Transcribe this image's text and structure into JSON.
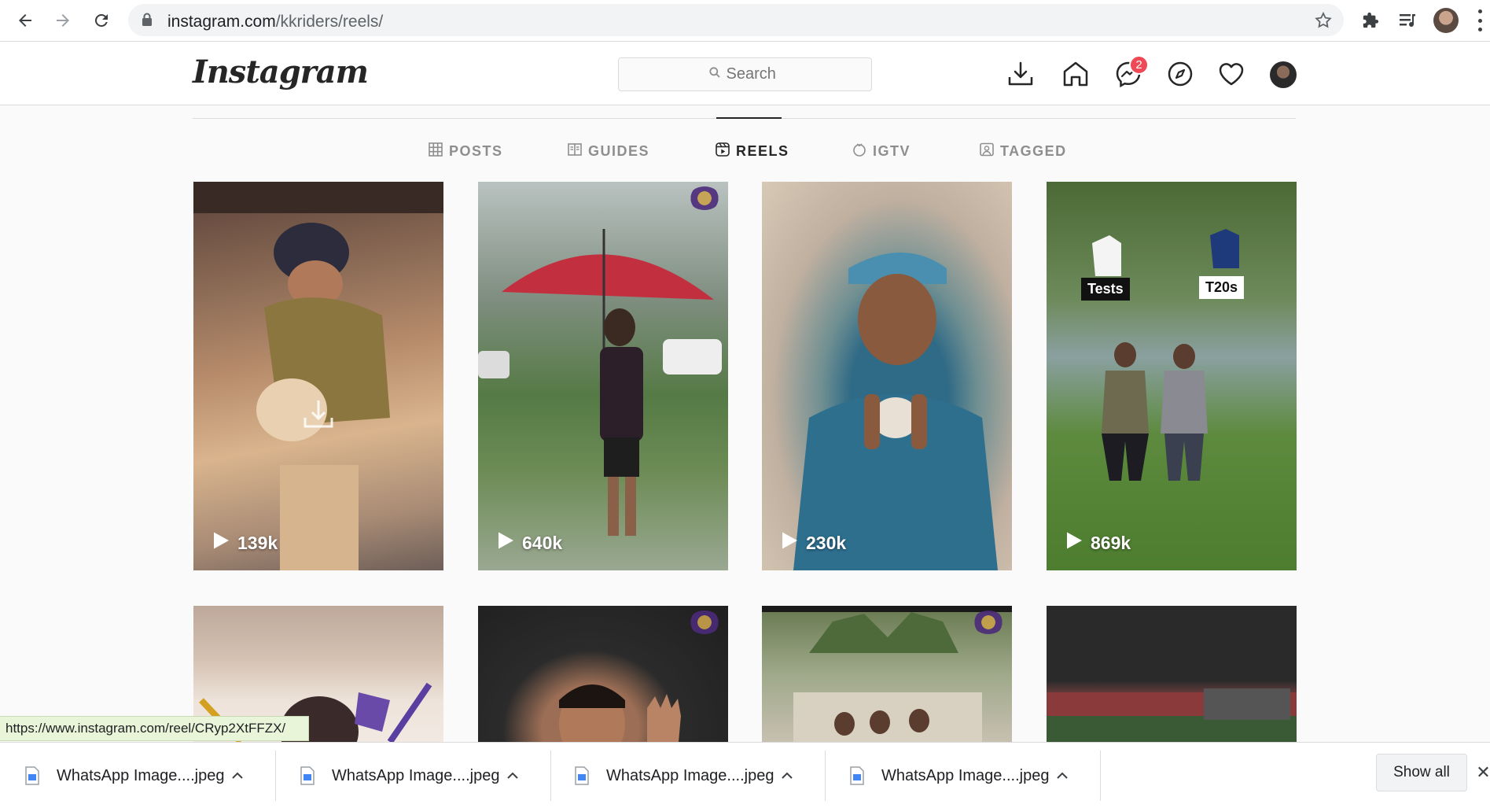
{
  "browser": {
    "url_host": "instagram.com",
    "url_path": "/kkriders/reels/"
  },
  "header": {
    "logo": "Instagram",
    "search_placeholder": "Search",
    "notification_badge": "2"
  },
  "tabs": [
    {
      "label": "POSTS",
      "icon": "grid-icon",
      "active": false
    },
    {
      "label": "GUIDES",
      "icon": "guide-icon",
      "active": false
    },
    {
      "label": "REELS",
      "icon": "reels-icon",
      "active": true
    },
    {
      "label": "IGTV",
      "icon": "igtv-icon",
      "active": false
    },
    {
      "label": "TAGGED",
      "icon": "tagged-icon",
      "active": false
    }
  ],
  "reels": [
    {
      "views": "139k"
    },
    {
      "views": "640k"
    },
    {
      "views": "230k"
    },
    {
      "views": "869k",
      "labels": [
        "Tests",
        "T20s"
      ]
    },
    {},
    {},
    {},
    {}
  ],
  "status_url": "https://www.instagram.com/reel/CRyp2XtFFZX/",
  "downloads": {
    "items": [
      {
        "name": "WhatsApp Image....jpeg"
      },
      {
        "name": "WhatsApp Image....jpeg"
      },
      {
        "name": "WhatsApp Image....jpeg"
      },
      {
        "name": "WhatsApp Image....jpeg"
      }
    ],
    "show_all": "Show all"
  },
  "colors": {
    "badge": "#ed4956",
    "page_bg": "#fafafa",
    "status_bg": "#e8f5d9"
  }
}
